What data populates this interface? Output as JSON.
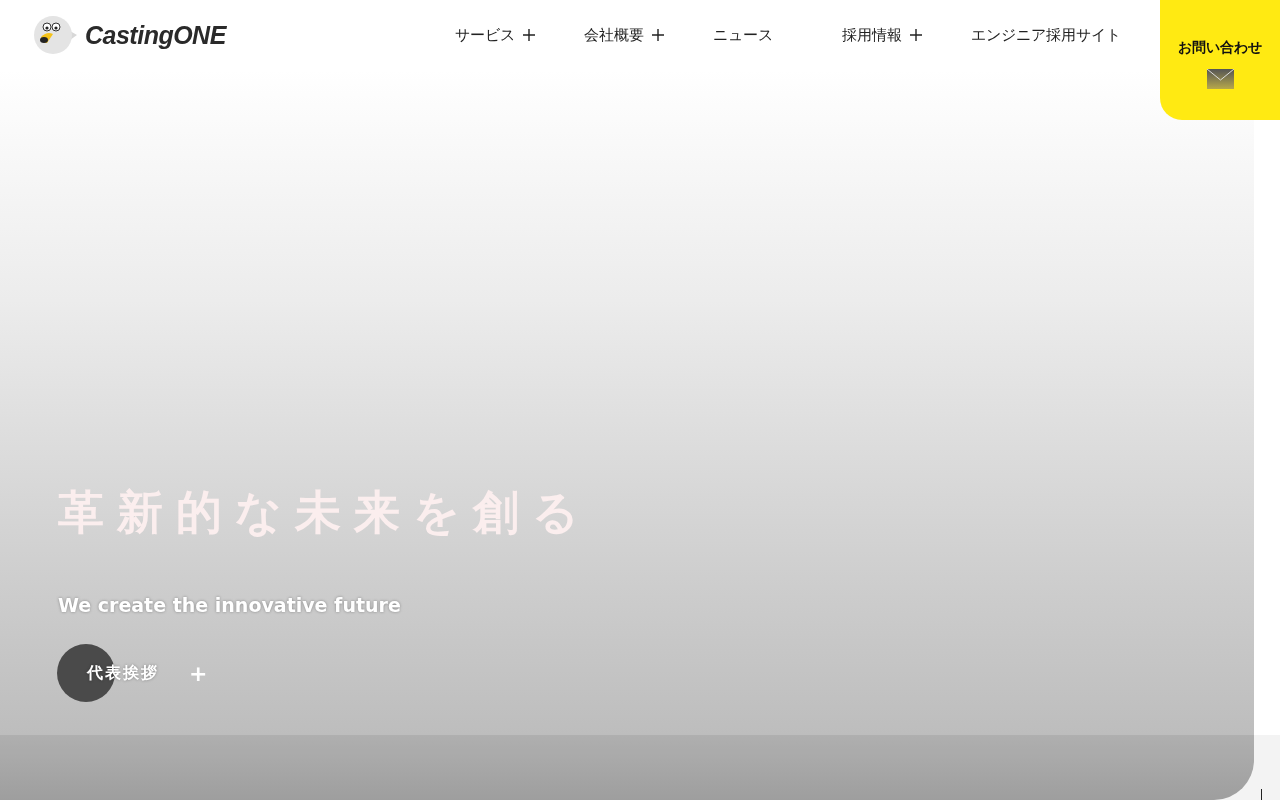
{
  "header": {
    "logo": "CastingONE",
    "nav": [
      {
        "label": "サービス",
        "expandable": true
      },
      {
        "label": "会社概要",
        "expandable": true
      },
      {
        "label": "ニュース",
        "expandable": false
      },
      {
        "label": "採用情報",
        "expandable": true
      },
      {
        "label": "エンジニア採用サイト",
        "expandable": false
      }
    ],
    "contact": {
      "label": "お問い合わせ"
    }
  },
  "hero": {
    "headline": "革新的な未来を創る",
    "subheadline": "We create the innovative future",
    "button": {
      "label": "代表挨拶",
      "icon": "+"
    }
  }
}
